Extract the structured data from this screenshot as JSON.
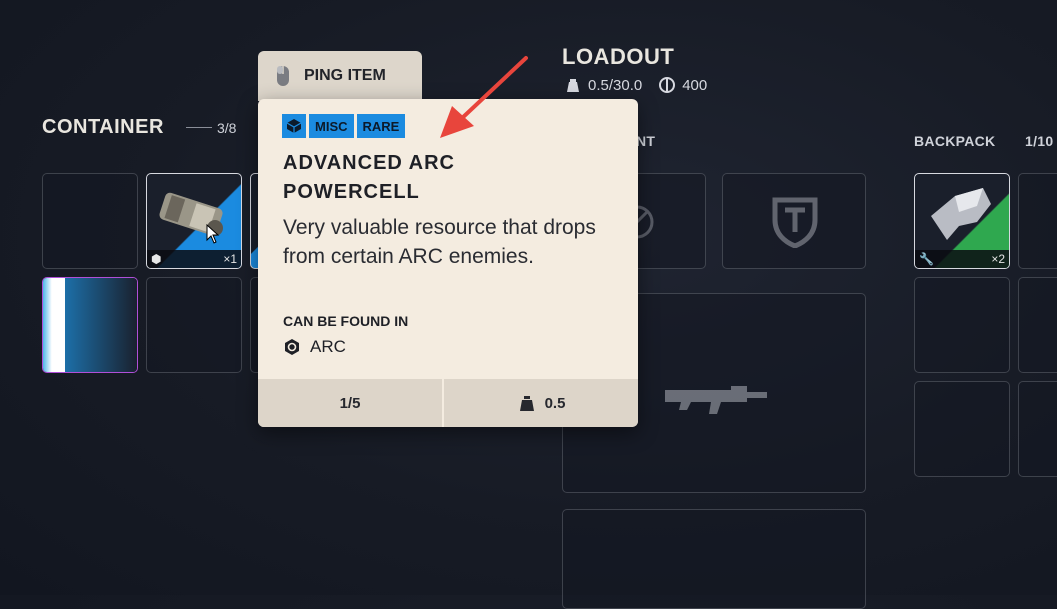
{
  "container": {
    "title": "CONTAINER",
    "count": "3/8",
    "qty_label": "×1"
  },
  "loadout": {
    "title": "LOADOUT",
    "weight": "0.5/30.0",
    "currency": "400",
    "partial_label": "NT"
  },
  "backpack": {
    "title": "BACKPACK",
    "count": "1/10",
    "qty_label": "×2"
  },
  "ping": {
    "label": "PING ITEM"
  },
  "item": {
    "tags": [
      "MISC",
      "RARE"
    ],
    "name": "ADVANCED ARC POWERCELL",
    "description": "Very valuable resource that drops from certain ARC enemies.",
    "found_label": "CAN BE FOUND IN",
    "found_source": "ARC",
    "stack": "1/5",
    "weight": "0.5"
  },
  "colors": {
    "rare_tag": "#1b8be0",
    "tooltip_bg": "#f4ece0",
    "uncommon_green": "#2fa84f",
    "epic_purple": "#b04fd8"
  }
}
